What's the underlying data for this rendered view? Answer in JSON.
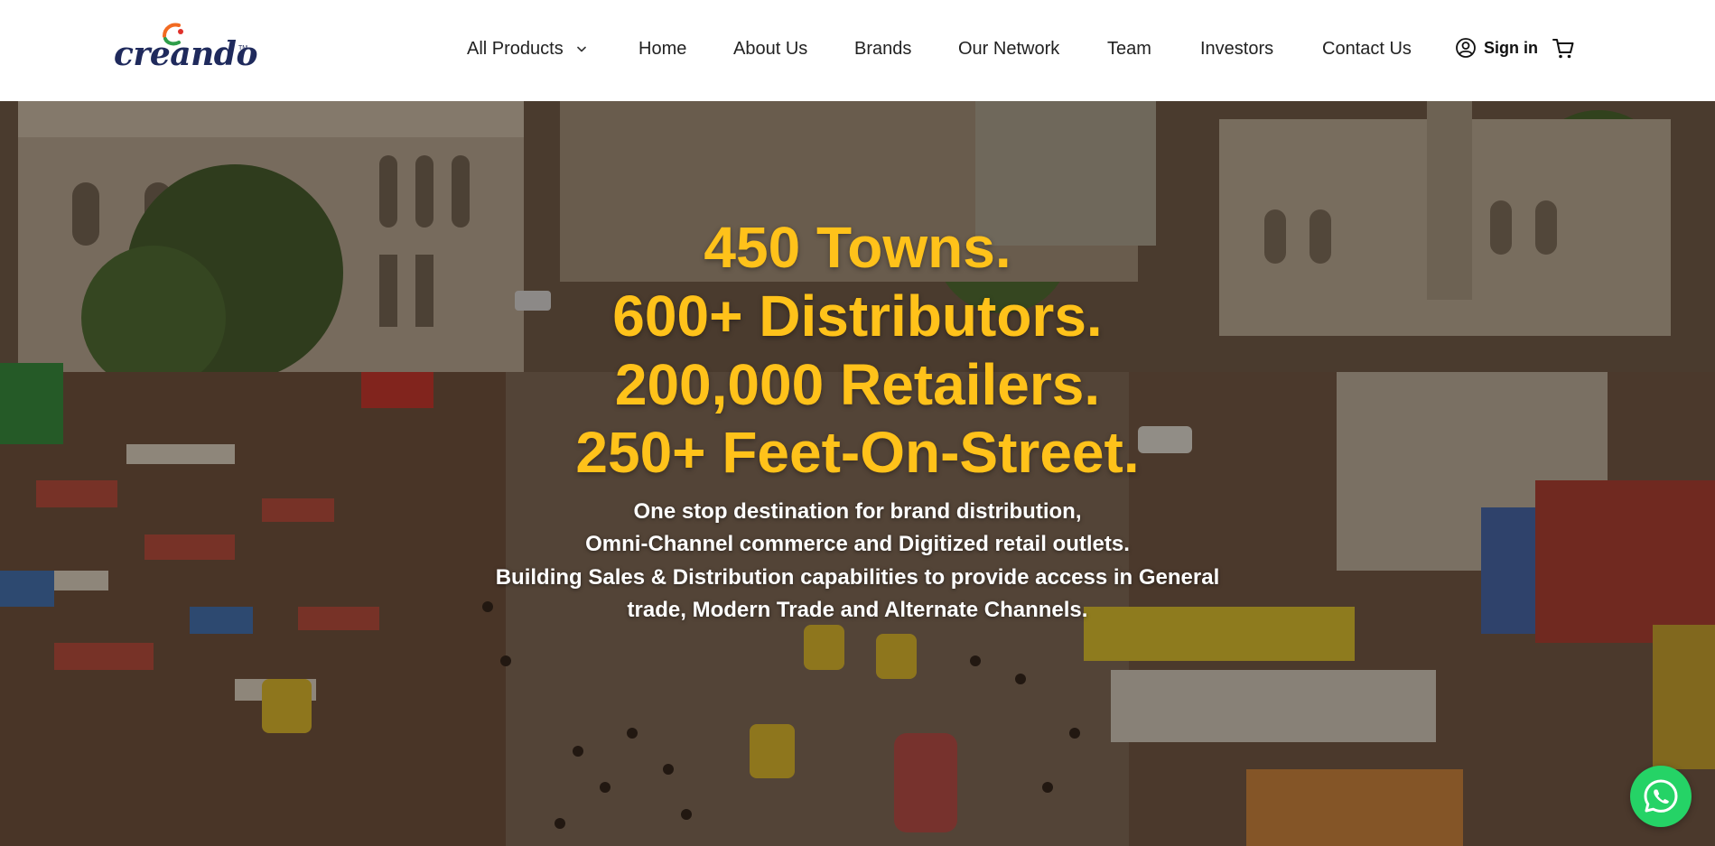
{
  "brand": {
    "name": "creando",
    "tm": "TM"
  },
  "nav": {
    "items": [
      {
        "label": "All Products"
      },
      {
        "label": "Home"
      },
      {
        "label": "About Us"
      },
      {
        "label": "Brands"
      },
      {
        "label": "Our Network"
      },
      {
        "label": "Team"
      },
      {
        "label": "Investors"
      },
      {
        "label": "Contact Us"
      }
    ],
    "signin_label": "Sign in"
  },
  "hero": {
    "headline_lines": [
      "450 Towns.",
      "600+ Distributors.",
      "200,000 Retailers.",
      "250+ Feet-On-Street."
    ],
    "sub_lines": [
      "One stop destination for brand distribution,",
      "Omni-Channel commerce and Digitized retail outlets.",
      "Building Sales & Distribution capabilities to provide access in General",
      "trade, Modern Trade and Alternate Channels."
    ]
  },
  "colors": {
    "headline": "#ffc21a",
    "whatsapp": "#25d366",
    "brand_navy": "#1f2a5c"
  },
  "icons": {
    "user": "user-circle-icon",
    "cart": "cart-icon",
    "whatsapp": "whatsapp-icon",
    "chevron": "chevron-down-icon"
  }
}
